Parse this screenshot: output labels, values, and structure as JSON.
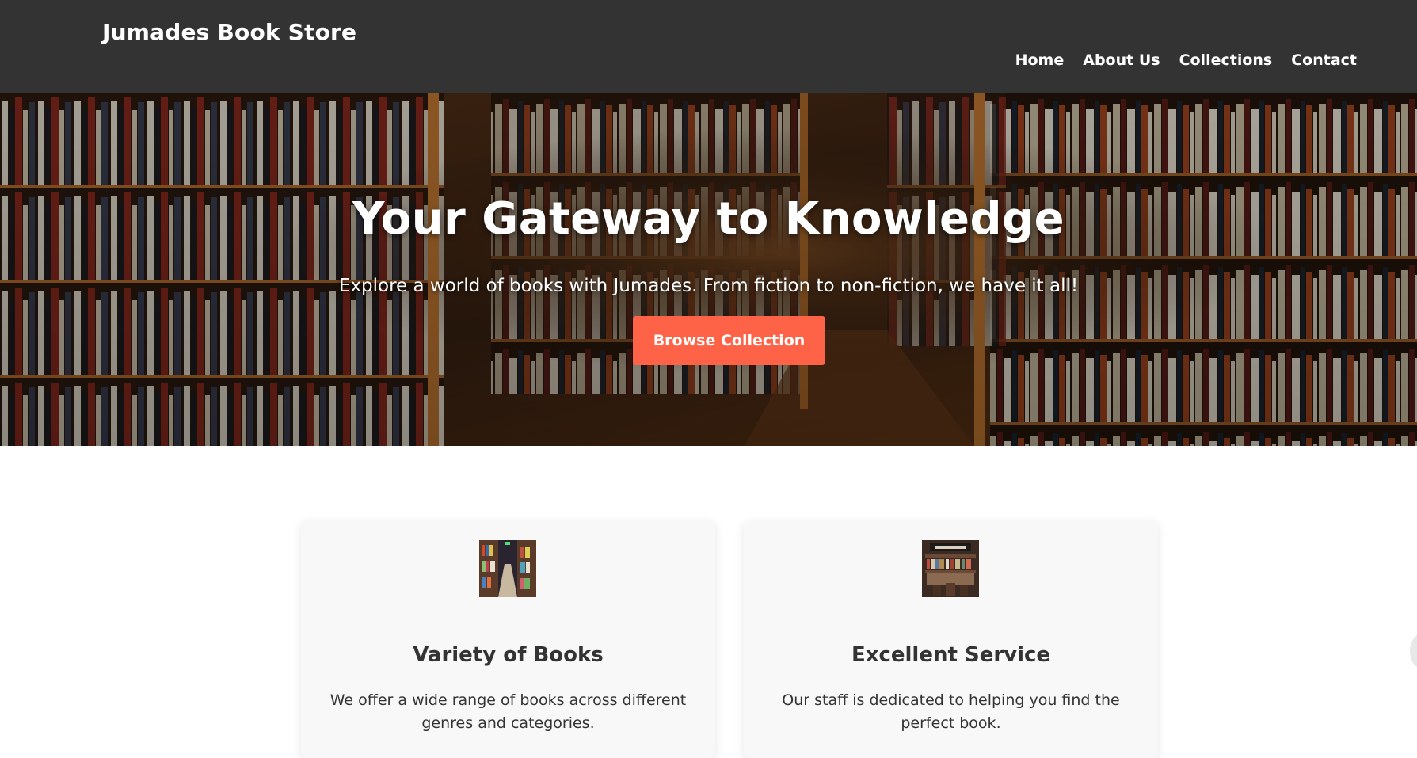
{
  "header": {
    "brand": "Jumades Book Store",
    "nav": [
      {
        "label": "Home"
      },
      {
        "label": "About Us"
      },
      {
        "label": "Collections"
      },
      {
        "label": "Contact"
      }
    ]
  },
  "hero": {
    "title": "Your Gateway to Knowledge",
    "subtitle": "Explore a world of books with Jumades. From fiction to non-fiction, we have it all!",
    "button_label": "Browse Collection"
  },
  "features": [
    {
      "title": "Variety of Books",
      "text": "We offer a wide range of books across different genres and categories."
    },
    {
      "title": "Excellent Service",
      "text": "Our staff is dedicated to helping you find the perfect book."
    }
  ],
  "colors": {
    "header_bg": "#333333",
    "accent": "#ff6347",
    "card_bg": "#f8f8f8",
    "text_dark": "#333333"
  }
}
